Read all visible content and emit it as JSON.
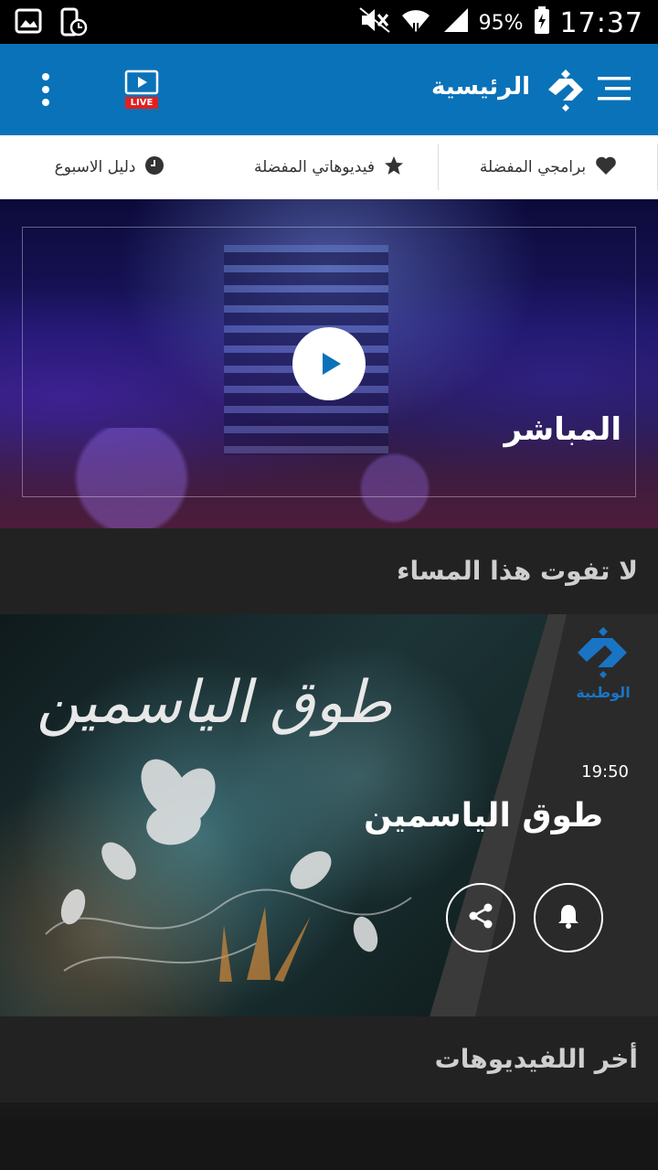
{
  "status_bar": {
    "battery": "95%",
    "time": "17:37"
  },
  "app_bar": {
    "title": "الرئيسية",
    "live_label": "LIVE",
    "colors": {
      "primary": "#0a72b8",
      "live_badge": "#e02020"
    },
    "icons": [
      "hamburger-menu-icon",
      "channel-logo-icon",
      "live-tv-icon",
      "more-vert-icon"
    ]
  },
  "tabs": [
    {
      "label": "دليل الاسبوع",
      "icon": "clock-icon"
    },
    {
      "label": "فيديوهاتي المفضلة",
      "icon": "star-icon"
    },
    {
      "label": "برامجي المفضلة",
      "icon": "heart-icon"
    }
  ],
  "hero": {
    "label": "المباشر",
    "icon": "play-icon"
  },
  "sections": {
    "tonight": "لا تفوت هذا المساء",
    "latest_videos": "أخر اللفيديوهات"
  },
  "program": {
    "calligraphy": "طوق الياسمين",
    "time": "19:50",
    "title": "طوق الياسمين",
    "channel_logo_text": "الوطنية",
    "actions": [
      "bell-icon",
      "share-icon"
    ]
  }
}
